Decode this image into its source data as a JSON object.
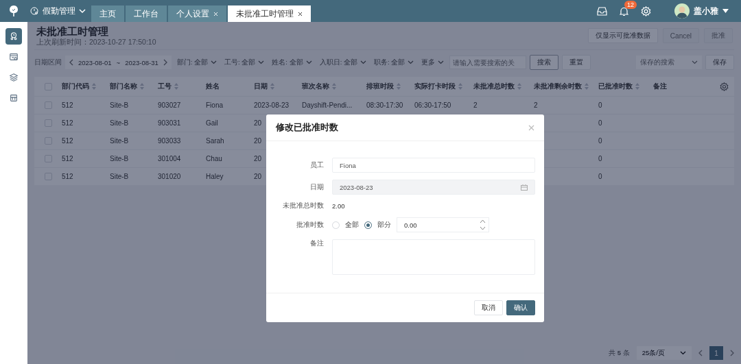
{
  "app": {
    "module": "假勤管理"
  },
  "tabs": [
    {
      "label": "主页",
      "closable": false,
      "selected": false
    },
    {
      "label": "工作台",
      "closable": false,
      "selected": false
    },
    {
      "label": "个人设置",
      "closable": true,
      "selected": false
    },
    {
      "label": "未批准工时管理",
      "closable": true,
      "selected": true
    }
  ],
  "header": {
    "notifications": "12",
    "user": "盖小雅"
  },
  "sidebar": {
    "items": [
      {
        "selected": true
      },
      {
        "selected": false
      },
      {
        "selected": false
      },
      {
        "selected": false
      }
    ]
  },
  "page": {
    "title": "未批准工时管理",
    "refreshed": "上次刷新时间：2023-10-27 17:50:10",
    "actions": [
      {
        "label": "仅显示可批准数据",
        "disabled": false
      },
      {
        "label": "Cancel",
        "disabled": true
      },
      {
        "label": "批准",
        "disabled": true
      }
    ]
  },
  "filters": {
    "range_label": "日期区间",
    "start": "2023-08-01",
    "separator": "~",
    "end": "2023-08-31",
    "dropdowns": [
      "部门: 全部",
      "工号: 全部",
      "姓名: 全部",
      "入职日: 全部",
      "职务: 全部",
      "更多"
    ],
    "search_placeholder": "请输入需要搜索的关",
    "search_button": "搜索",
    "reset_button": "重置",
    "saved_placeholder": "保存的搜索",
    "save_button": "保存"
  },
  "table": {
    "all_checked": false,
    "columns": [
      {
        "label": "部门代码",
        "sortable": true
      },
      {
        "label": "部门名称",
        "sortable": true
      },
      {
        "label": "工号",
        "sortable": true
      },
      {
        "label": "姓名",
        "sortable": false
      },
      {
        "label": "日期",
        "sortable": true
      },
      {
        "label": "班次名称",
        "sortable": true
      },
      {
        "label": "排班时段",
        "sortable": true
      },
      {
        "label": "实际打卡时段",
        "sortable": true
      },
      {
        "label": "未批准总时数",
        "sortable": true
      },
      {
        "label": "未批准剩余时数",
        "sortable": true
      },
      {
        "label": "已批准时数",
        "sortable": true
      },
      {
        "label": "备注",
        "sortable": false
      }
    ],
    "rows": [
      {
        "checked": false,
        "cells": [
          "512",
          "Site-B",
          "903027",
          "Fiona",
          "2023-08-23",
          "Dayshift-Pendi...",
          "08:30-17:30",
          "06:30-17:50",
          "2",
          "2",
          "0"
        ]
      },
      {
        "checked": false,
        "cells": [
          "512",
          "Site-B",
          "903031",
          "Gail",
          "20",
          null,
          null,
          null,
          null,
          null,
          "0"
        ]
      },
      {
        "checked": false,
        "cells": [
          "512",
          "Site-B",
          "903033",
          "Sarah",
          "20",
          null,
          null,
          null,
          null,
          null,
          "0"
        ]
      },
      {
        "checked": false,
        "cells": [
          "512",
          "Site-B",
          "301004",
          "Chau",
          "20",
          null,
          null,
          null,
          null,
          null,
          "0"
        ]
      },
      {
        "checked": false,
        "cells": [
          "512",
          "Site-B",
          "301020",
          "Haley",
          "20",
          null,
          null,
          null,
          null,
          null,
          "0"
        ]
      }
    ]
  },
  "pagination": {
    "total": "共 **5** 条",
    "page_size": "25条/页",
    "pages": [
      {
        "label": "1",
        "selected": true
      }
    ]
  },
  "modal": {
    "title": "修改已批准时数",
    "fields": [
      {
        "kind": "input",
        "label": "员工",
        "value": "Fiona"
      },
      {
        "kind": "date",
        "label": "日期",
        "value": "2023-08-23",
        "disabled": true
      },
      {
        "kind": "text",
        "label": "未批准总时数",
        "value": "2.00"
      },
      {
        "kind": "radio",
        "label": "批准时数",
        "options": [
          {
            "label": "全部",
            "selected": false
          },
          {
            "label": "部分",
            "selected": true
          }
        ],
        "value": "0.00"
      },
      {
        "kind": "textarea",
        "label": "备注"
      }
    ],
    "buttons": [
      {
        "label": "取消",
        "kind": "default"
      },
      {
        "label": "确认",
        "kind": "primary"
      }
    ]
  }
}
